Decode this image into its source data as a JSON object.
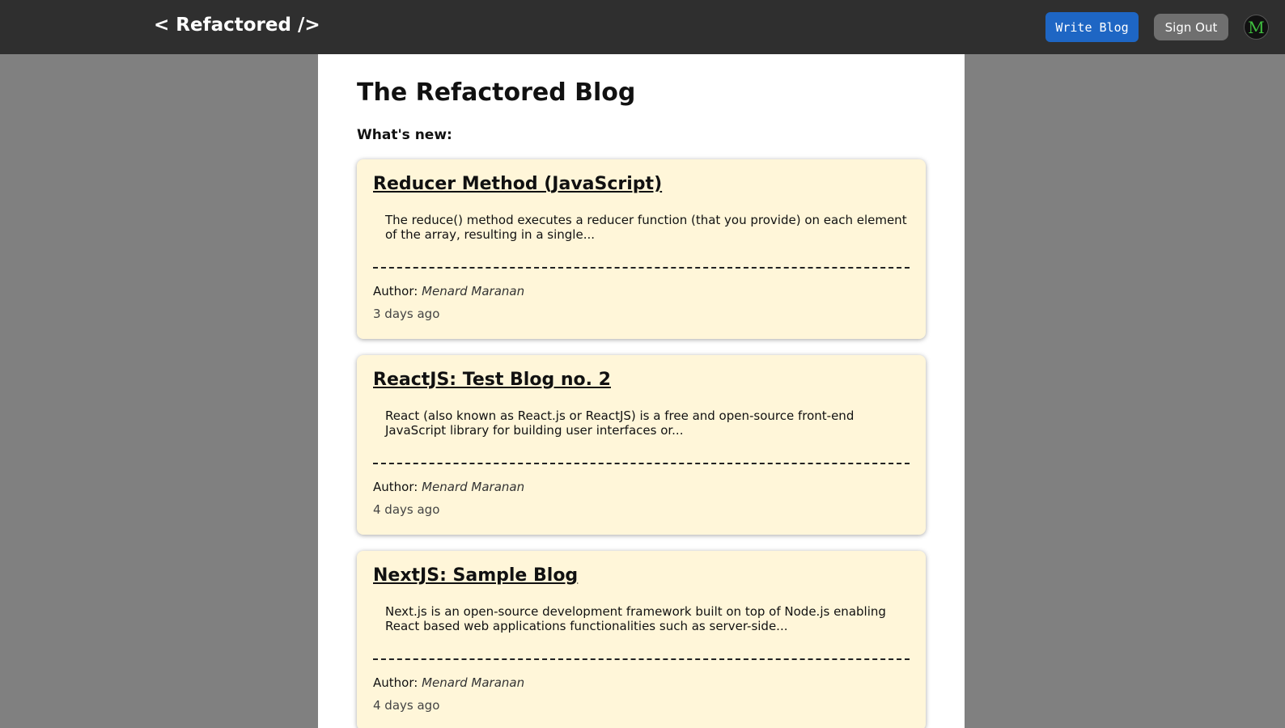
{
  "navbar": {
    "brand": "< Refactored />",
    "write_label": "Write Blog",
    "signout_label": "Sign Out",
    "avatar_letter": "M"
  },
  "page": {
    "title": "The Refactored Blog",
    "section_label": "What's new:"
  },
  "posts": [
    {
      "title": "Reducer Method (JavaScript)",
      "excerpt": "The reduce() method executes a reducer function (that you provide) on each element of the array, resulting in a single...",
      "author_label": "Author:",
      "author": "Menard Maranan",
      "date": "3 days ago"
    },
    {
      "title": "ReactJS: Test Blog no. 2",
      "excerpt": "React (also known as React.js or ReactJS) is a free and open-source front-end JavaScript library for building user interfaces or...",
      "author_label": "Author:",
      "author": "Menard Maranan",
      "date": "4 days ago"
    },
    {
      "title": "NextJS: Sample Blog",
      "excerpt": "Next.js is an open-source development framework built on top of Node.js enabling React based web applications functionalities such as server-side...",
      "author_label": "Author:",
      "author": "Menard Maranan",
      "date": "4 days ago"
    }
  ],
  "colors": {
    "navbar_bg": "#2f2f2f",
    "page_bg": "#808080",
    "accent_button": "#1e66c4",
    "card_bg": "#fff6d9",
    "avatar_letter": "#3fbf3f"
  }
}
